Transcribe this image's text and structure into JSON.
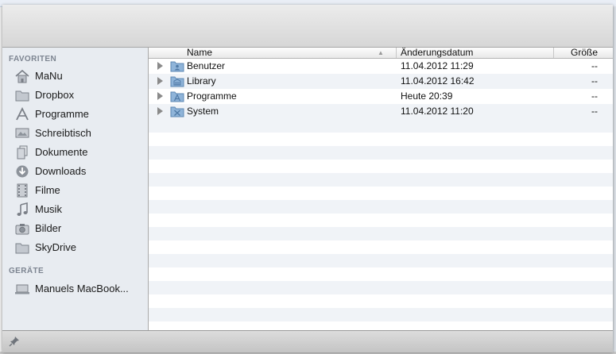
{
  "sidebar": {
    "favorites_title": "FAVORITEN",
    "favorites": [
      {
        "label": "MaNu",
        "icon": "home-icon"
      },
      {
        "label": "Dropbox",
        "icon": "folder-icon"
      },
      {
        "label": "Programme",
        "icon": "applications-icon"
      },
      {
        "label": "Schreibtisch",
        "icon": "desktop-icon"
      },
      {
        "label": "Dokumente",
        "icon": "documents-icon"
      },
      {
        "label": "Downloads",
        "icon": "downloads-icon"
      },
      {
        "label": "Filme",
        "icon": "movies-icon"
      },
      {
        "label": "Musik",
        "icon": "music-icon"
      },
      {
        "label": "Bilder",
        "icon": "pictures-icon"
      },
      {
        "label": "SkyDrive",
        "icon": "folder-icon"
      }
    ],
    "devices_title": "GERÄTE",
    "devices": [
      {
        "label": "Manuels MacBook...",
        "icon": "laptop-icon"
      }
    ]
  },
  "columns": {
    "name": "Name",
    "date": "Änderungsdatum",
    "size": "Größe"
  },
  "files": [
    {
      "name": "Benutzer",
      "date": "11.04.2012 11:29",
      "size": "--",
      "icon": "users-folder-icon"
    },
    {
      "name": "Library",
      "date": "11.04.2012 16:42",
      "size": "--",
      "icon": "library-folder-icon"
    },
    {
      "name": "Programme",
      "date": "Heute 20:39",
      "size": "--",
      "icon": "applications-folder-icon"
    },
    {
      "name": "System",
      "date": "11.04.2012 11:20",
      "size": "--",
      "icon": "system-folder-icon"
    }
  ],
  "colors": {
    "sidebar_bg": "#e8ecf1",
    "row_alt": "#f0f3f7",
    "folder_blue": "#8fb4d9"
  }
}
